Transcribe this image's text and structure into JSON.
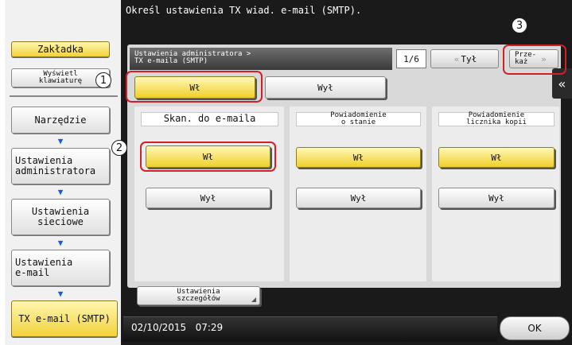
{
  "title": "Określ ustawienia TX wiad. e-mail (SMTP).",
  "sidebar": {
    "bookmark": "Zakładka",
    "show_keyboard": "Wyświetl\nklawiaturę",
    "tool": "Narzędzie",
    "admin_settings": "Ustawienia\nadministratora",
    "network_settings": "Ustawienia\nsieciowe",
    "email_settings": "Ustawienia\ne-mail",
    "tx_email": "TX e-mail (SMTP)"
  },
  "header": {
    "breadcrumb": "Ustawienia administratora >\nTX e-maila (SMTP)",
    "page_indicator": "1/6",
    "back_label": "Tył",
    "forward_label": "Prze-\nkaż"
  },
  "main_toggle": {
    "on": "Wł",
    "off": "Wył"
  },
  "columns": [
    {
      "heading": "Skan. do e-maila",
      "on": "Wł",
      "off": "Wył"
    },
    {
      "heading": "Powiadomienie\no stanie",
      "on": "Wł",
      "off": "Wył"
    },
    {
      "heading": "Powiadomienie\nlicznika kopii",
      "on": "Wł",
      "off": "Wył"
    }
  ],
  "details_button": "Ustawienia\nszczegółów",
  "status": {
    "datetime": "02/10/2015   07:29"
  },
  "ok_label": "OK",
  "callouts": [
    "1",
    "2",
    "3"
  ],
  "colors": {
    "accent_yellow": "#f2d23a",
    "callout_red": "#d0202a",
    "panel_dark": "#1a1a1a",
    "arrow_blue": "#1a5fd0"
  }
}
